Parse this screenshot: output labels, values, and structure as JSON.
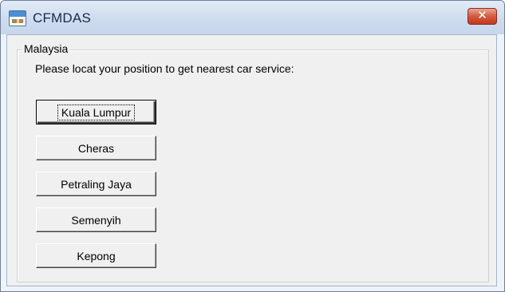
{
  "window": {
    "title": "CFMDAS",
    "close_glyph": "✕"
  },
  "group": {
    "label": "Malaysia",
    "prompt": "Please locat your position to get nearest car service:"
  },
  "locations": [
    {
      "label": "Kuala Lumpur",
      "default": true
    },
    {
      "label": "Cheras"
    },
    {
      "label": "Petraling Jaya"
    },
    {
      "label": "Semenyih"
    },
    {
      "label": "Kepong"
    }
  ]
}
